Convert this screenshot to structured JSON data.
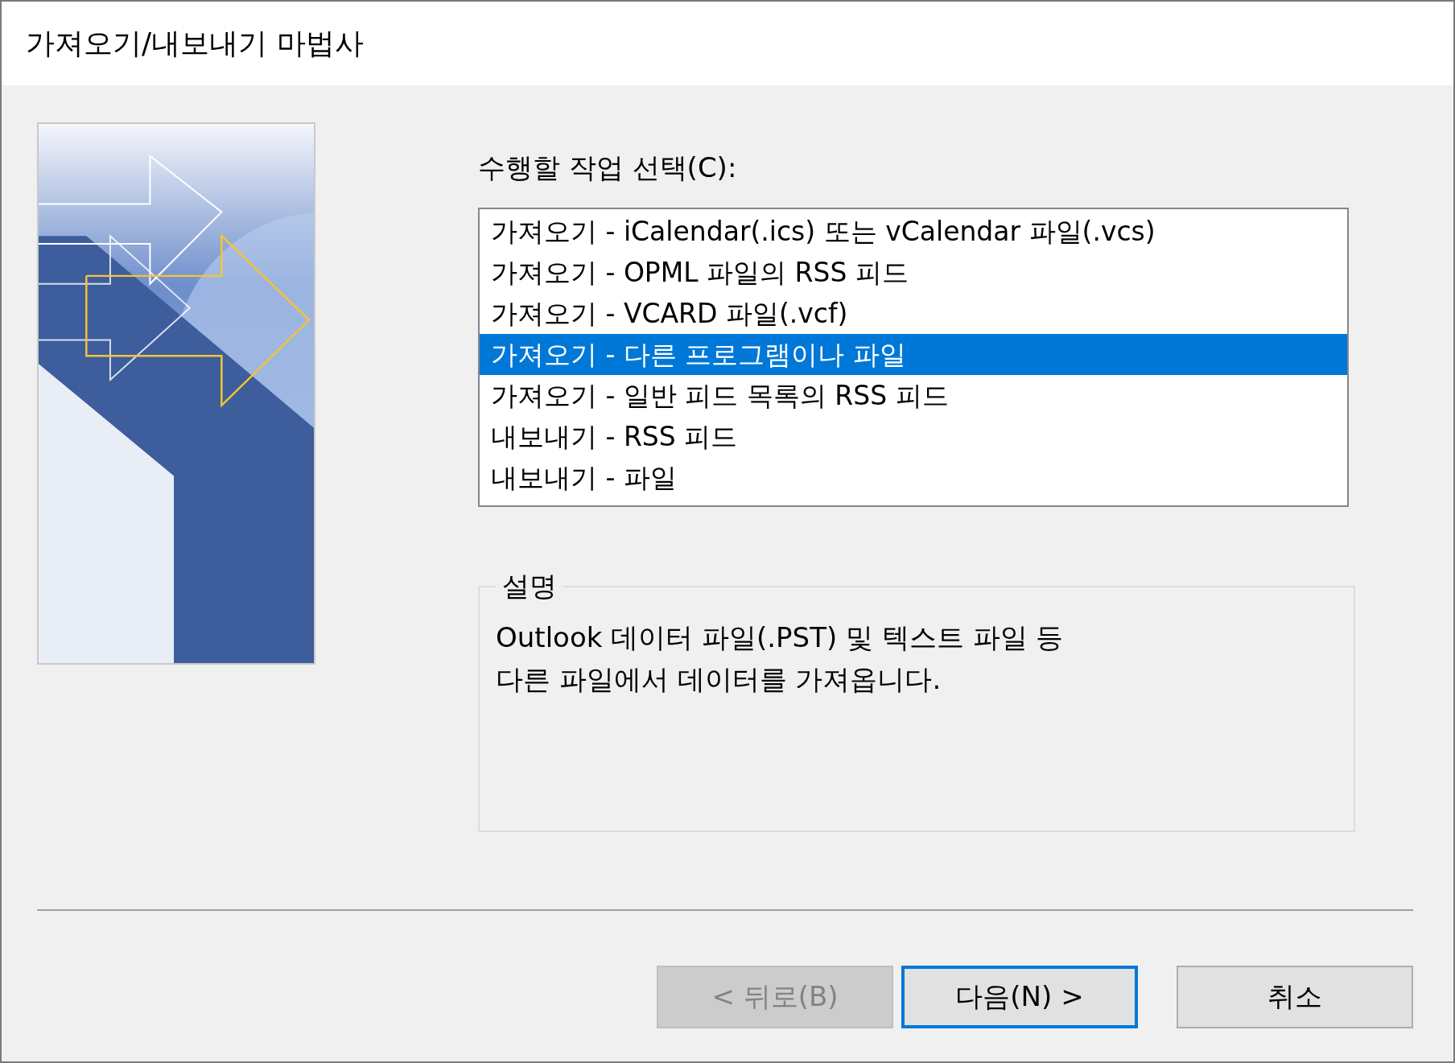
{
  "window": {
    "title": "가져오기/내보내기 마법사"
  },
  "task_list": {
    "label": "수행할 작업 선택(C):",
    "items": [
      {
        "text": "가져오기 - iCalendar(.ics) 또는 vCalendar 파일(.vcs)",
        "selected": false
      },
      {
        "text": "가져오기 - OPML 파일의 RSS 피드",
        "selected": false
      },
      {
        "text": "가져오기 - VCARD 파일(.vcf)",
        "selected": false
      },
      {
        "text": "가져오기 - 다른 프로그램이나 파일",
        "selected": true
      },
      {
        "text": "가져오기 - 일반 피드 목록의 RSS 피드",
        "selected": false
      },
      {
        "text": "내보내기 - RSS 피드",
        "selected": false
      },
      {
        "text": "내보내기 - 파일",
        "selected": false
      }
    ]
  },
  "description": {
    "legend": "설명",
    "text": "Outlook 데이터 파일(.PST) 및 텍스트 파일 등\n다른 파일에서 데이터를 가져옵니다."
  },
  "buttons": [
    {
      "kind": "back",
      "label": "< 뒤로(B)",
      "disabled": true,
      "default": false
    },
    {
      "kind": "next",
      "label": "다음(N) >",
      "disabled": false,
      "default": true
    },
    {
      "kind": "cancel",
      "label": "취소",
      "disabled": false,
      "default": false
    }
  ]
}
